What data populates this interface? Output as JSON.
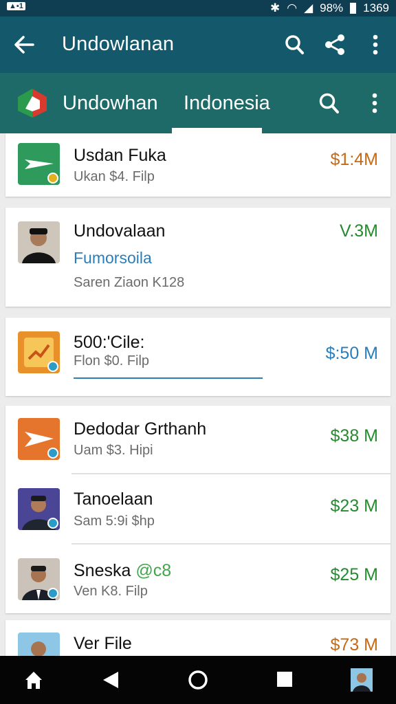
{
  "status_bar": {
    "left_icon": "notification-icon",
    "battery": "98%",
    "time": "1369"
  },
  "app_bar": {
    "title": "Undowlanan"
  },
  "tab_bar": {
    "app_name": "Undowhan",
    "tab_active": "Indonesia"
  },
  "cards": [
    {
      "rows": [
        {
          "name": "Usdan Fuka",
          "sub": "Ukan $4. Filp",
          "amount": "$1:4M",
          "amount_color": "#c56a16"
        }
      ]
    },
    {
      "rows": [
        {
          "name": "Undovalaan",
          "link": "Fumorsoila",
          "sub": "Saren Ziaon K128",
          "amount": "V.3M",
          "amount_color": "#268a2f"
        }
      ]
    },
    {
      "rows": [
        {
          "name": "500:'Cile:",
          "sub": "Flon $0. Filp",
          "amount": "$:50 M",
          "amount_color": "#2a7db9"
        }
      ]
    },
    {
      "rows": [
        {
          "name": "Dedodar Grthanh",
          "sub": "Uam $3. Hipi",
          "amount": "$38 M",
          "amount_color": "#268a2f"
        },
        {
          "name": "Tanoelaan",
          "sub": "Sam 5:9i $hp",
          "amount": "$23 M",
          "amount_color": "#268a2f"
        },
        {
          "name": "Sneska",
          "name_tag": "@c8",
          "sub": "Ven K8. Filp",
          "amount": "$25 M",
          "amount_color": "#268a2f"
        }
      ]
    },
    {
      "rows": [
        {
          "name": "Ver File",
          "amount": "$73 M",
          "amount_color": "#c56a16"
        }
      ]
    }
  ],
  "nav": {
    "home": "home-icon",
    "back": "back-icon",
    "recents": "square-icon",
    "circle": "circle-icon"
  }
}
